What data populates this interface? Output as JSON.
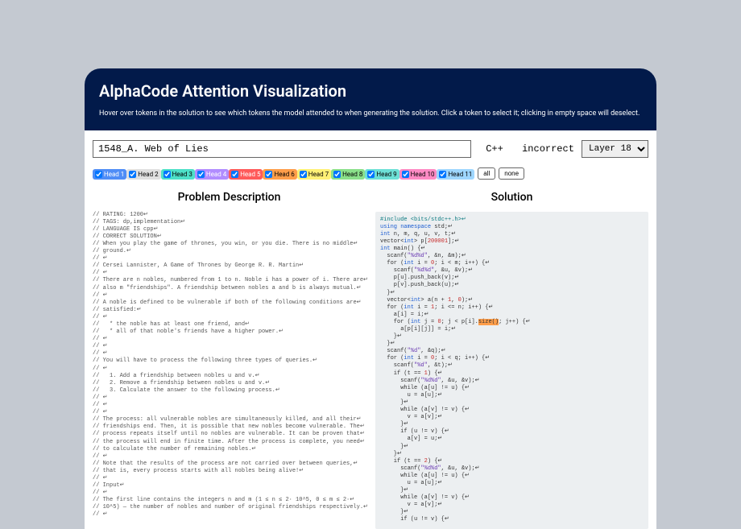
{
  "header": {
    "title": "AlphaCode Attention Visualization",
    "subtitle": "Hover over tokens in the solution to see which tokens the model attended to when generating the solution. Click a token to select it; clicking in empty space will deselect."
  },
  "controls": {
    "problem_name": "1548_A. Web of Lies",
    "lang": "C++",
    "status": "incorrect",
    "layer": "Layer 18",
    "heads": [
      {
        "label": "Head 1",
        "color": "#4f8df6",
        "text": "#fff"
      },
      {
        "label": "Head 2",
        "color": "#e0e0e0",
        "text": "#000"
      },
      {
        "label": "Head 3",
        "color": "#4de0c8",
        "text": "#000"
      },
      {
        "label": "Head 4",
        "color": "#b18cff",
        "text": "#fff"
      },
      {
        "label": "Head 5",
        "color": "#ff5a5a",
        "text": "#fff"
      },
      {
        "label": "Head 6",
        "color": "#ff9e4a",
        "text": "#000"
      },
      {
        "label": "Head 7",
        "color": "#fff176",
        "text": "#000"
      },
      {
        "label": "Head 8",
        "color": "#8ae08a",
        "text": "#000"
      },
      {
        "label": "Head 9",
        "color": "#6de0d6",
        "text": "#000"
      },
      {
        "label": "Head 10",
        "color": "#ff8ac4",
        "text": "#000"
      },
      {
        "label": "Head 11",
        "color": "#9ed6ff",
        "text": "#000"
      }
    ],
    "all_label": "all",
    "none_label": "none"
  },
  "cols": {
    "problem_title": "Problem Description",
    "solution_title": "Solution"
  },
  "problem_lines": [
    "// RATING: 1200↵",
    "// TAGS: dp,implementation↵",
    "// LANGUAGE IS cpp↵",
    "// CORRECT SOLUTION↵",
    "// When you play the game of thrones, you win, or you die. There is no middle↵",
    "// ground.↵",
    "// ↵",
    "// Cersei Lannister, A Game of Thrones by George R. R. Martin↵",
    "// ↵",
    "// There are n nobles, numbered from 1 to n. Noble i has a power of i. There are↵",
    "// also m \"friendships\". A friendship between nobles a and b is always mutual.↵",
    "// ↵",
    "// A noble is defined to be vulnerable if both of the following conditions are↵",
    "// satisfied:↵",
    "// ↵",
    "//   * the noble has at least one friend, and↵",
    "//   * all of that noble's friends have a higher power.↵",
    "// ↵",
    "// ↵",
    "// ↵",
    "// You will have to process the following three types of queries.↵",
    "// ↵",
    "//   1. Add a friendship between nobles u and v.↵",
    "//   2. Remove a friendship between nobles u and v.↵",
    "//   3. Calculate the answer to the following process.↵",
    "// ↵",
    "// ↵",
    "// ↵",
    "// The process: all vulnerable nobles are simultaneously killed, and all their↵",
    "// friendships end. Then, it is possible that new nobles become vulnerable. The↵",
    "// process repeats itself until no nobles are vulnerable. It can be proven that↵",
    "// the process will end in finite time. After the process is complete, you need↵",
    "// to calculate the number of remaining nobles.↵",
    "// ↵",
    "// Note that the results of the process are not carried over between queries,↵",
    "// that is, every process starts with all nobles being alive!↵",
    "// ↵",
    "// Input↵",
    "// ↵",
    "// The first line contains the integers n and m (1 ≤ n ≤ 2· 10^5, 0 ≤ m ≤ 2·↵",
    "// 10^5) — the number of nobles and number of original friendships respectively.↵",
    "// ↵"
  ],
  "solution": {
    "l0": "#include <bits/stdc++.h>↵",
    "l1a": "using ",
    "l1b": "namespace ",
    "l1c": "std;↵",
    "l2a": "int",
    "l2b": " n, m, q, u, v, t;↵",
    "l3a": "vector<",
    "l3b": "int",
    "l3c": "> p[",
    "l3d": "200001",
    "l3e": "];↵",
    "l4a": "int",
    "l4b": " main() {↵",
    "l5a": "  scanf(",
    "l5b": "\"%d%d\"",
    "l5c": ", &n, &m);↵",
    "l6a": "  for (",
    "l6b": "int",
    "l6c": " i = ",
    "l6d": "0",
    "l6e": "; i < m; i++) {↵",
    "l7a": "    scanf(",
    "l7b": "\"%d%d\"",
    "l7c": ", &u, &v);↵",
    "l8": "    p[u].push_back(v);↵",
    "l9": "    p[v].push_back(u);↵",
    "l10": "  }↵",
    "l11a": "  vector<",
    "l11b": "int",
    "l11c": "> a(n + ",
    "l11d": "1",
    "l11e": ", ",
    "l11f": "0",
    "l11g": ");↵",
    "l12a": "  for (",
    "l12b": "int",
    "l12c": " i = ",
    "l12d": "1",
    "l12e": "; i <= n; i++) {↵",
    "l13": "    a[i] = i;↵",
    "l14a": "    for (",
    "l14b": "int",
    "l14c": " j = ",
    "l14d": "0",
    "l14e": "; j < p[i].",
    "l14f": "size()",
    "l14g": "; j++) {↵",
    "l15": "      a[p[i][j]] = i;↵",
    "l16": "    }↵",
    "l17": "  }↵",
    "l18a": "  scanf(",
    "l18b": "\"%d\"",
    "l18c": ", &q);↵",
    "l19a": "  for (",
    "l19b": "int",
    "l19c": " i = ",
    "l19d": "0",
    "l19e": "; i < q; i++) {↵",
    "l20a": "    scanf(",
    "l20b": "\"%d\"",
    "l20c": ", &t);↵",
    "l21a": "    if (t == ",
    "l21b": "1",
    "l21c": ") {↵",
    "l22a": "      scanf(",
    "l22b": "\"%d%d\"",
    "l22c": ", &u, &v);↵",
    "l23": "      while (a[u] != u) {↵",
    "l24": "        u = a[u];↵",
    "l25": "      }↵",
    "l26": "      while (a[v] != v) {↵",
    "l27": "        v = a[v];↵",
    "l28": "      }↵",
    "l29": "      if (u != v) {↵",
    "l30": "        a[v] = u;↵",
    "l31": "      }↵",
    "l32": "    }↵",
    "l33a": "    if (t == ",
    "l33b": "2",
    "l33c": ") {↵",
    "l34a": "      scanf(",
    "l34b": "\"%d%d\"",
    "l34c": ", &u, &v);↵",
    "l35": "      while (a[u] != u) {↵",
    "l36": "        u = a[u];↵",
    "l37": "      }↵",
    "l38": "      while (a[v] != v) {↵",
    "l39": "        v = a[v];↵",
    "l40": "      }↵",
    "l41": "      if (u != v) {↵"
  }
}
